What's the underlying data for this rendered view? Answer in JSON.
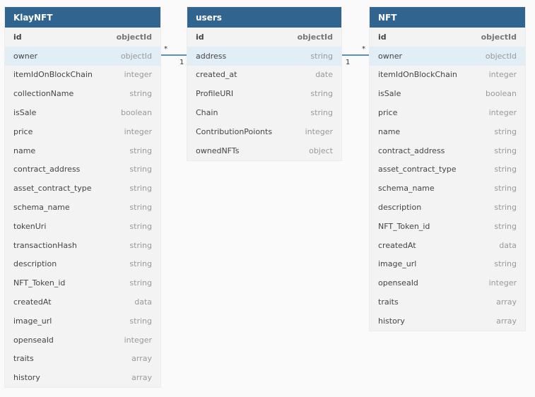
{
  "tables": {
    "klaynft": {
      "title": "KlayNFT",
      "rows": [
        {
          "name": "id",
          "type": "objectId"
        },
        {
          "name": "owner",
          "type": "objectId"
        },
        {
          "name": "itemIdOnBlockChain",
          "type": "integer"
        },
        {
          "name": "collectionName",
          "type": "string"
        },
        {
          "name": "isSale",
          "type": "boolean"
        },
        {
          "name": "price",
          "type": "integer"
        },
        {
          "name": "name",
          "type": "string"
        },
        {
          "name": "contract_address",
          "type": "string"
        },
        {
          "name": "asset_contract_type",
          "type": "string"
        },
        {
          "name": "schema_name",
          "type": "string"
        },
        {
          "name": "tokenUri",
          "type": "string"
        },
        {
          "name": "transactionHash",
          "type": "string"
        },
        {
          "name": "description",
          "type": "string"
        },
        {
          "name": "NFT_Token_id",
          "type": "string"
        },
        {
          "name": "createdAt",
          "type": "data"
        },
        {
          "name": "image_url",
          "type": "string"
        },
        {
          "name": "openseaId",
          "type": "integer"
        },
        {
          "name": "traits",
          "type": "array"
        },
        {
          "name": "history",
          "type": "array"
        }
      ]
    },
    "users": {
      "title": "users",
      "rows": [
        {
          "name": "id",
          "type": "objectId"
        },
        {
          "name": "address",
          "type": "string"
        },
        {
          "name": "created_at",
          "type": "date"
        },
        {
          "name": "ProfileURI",
          "type": "string"
        },
        {
          "name": "Chain",
          "type": "string"
        },
        {
          "name": "ContributionPoionts",
          "type": "integer"
        },
        {
          "name": "ownedNFTs",
          "type": "object"
        }
      ]
    },
    "nft": {
      "title": "NFT",
      "rows": [
        {
          "name": "id",
          "type": "objectId"
        },
        {
          "name": "owner",
          "type": "objectId"
        },
        {
          "name": "itemIdOnBlockChain",
          "type": "integer"
        },
        {
          "name": "isSale",
          "type": "boolean"
        },
        {
          "name": "price",
          "type": "integer"
        },
        {
          "name": "name",
          "type": "string"
        },
        {
          "name": "contract_address",
          "type": "string"
        },
        {
          "name": "asset_contract_type",
          "type": "string"
        },
        {
          "name": "schema_name",
          "type": "string"
        },
        {
          "name": "description",
          "type": "string"
        },
        {
          "name": "NFT_Token_id",
          "type": "string"
        },
        {
          "name": "createdAt",
          "type": "data"
        },
        {
          "name": "image_url",
          "type": "string"
        },
        {
          "name": "openseaId",
          "type": "integer"
        },
        {
          "name": "traits",
          "type": "array"
        },
        {
          "name": "history",
          "type": "array"
        }
      ]
    }
  },
  "relations": [
    {
      "from": "klaynft.owner",
      "to": "users.address",
      "from_card": "*",
      "to_card": "1"
    },
    {
      "from": "nft.owner",
      "to": "users.address",
      "from_card": "*",
      "to_card": "1"
    }
  ]
}
